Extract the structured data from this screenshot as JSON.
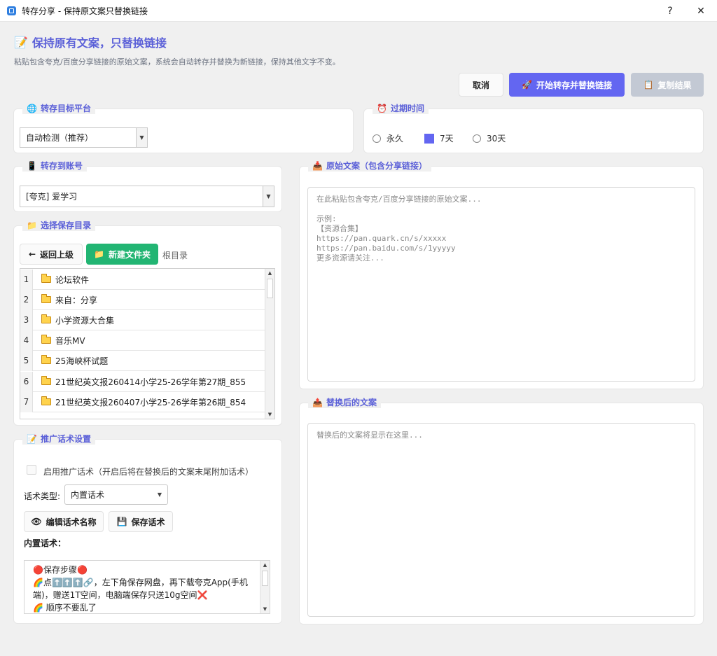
{
  "window": {
    "title": "转存分享 - 保持原文案只替换链接",
    "help": "?",
    "close": "✕"
  },
  "header": {
    "title": "保持原有文案，只替换链接",
    "description": "粘贴包含夸克/百度分享链接的原始文案，系统会自动转存并替换为新链接，保持其他文字不变。"
  },
  "actions": {
    "cancel": "取消",
    "start": "开始转存并替换链接",
    "copy": "复制结果"
  },
  "platform": {
    "legend": "转存目标平台",
    "selected": "自动检测（推荐）"
  },
  "expiry": {
    "legend": "过期时间",
    "options": [
      "永久",
      "7天",
      "30天"
    ],
    "selected": "7天"
  },
  "account": {
    "legend": "转存到账号",
    "selected": "[夸克] 爱学习"
  },
  "folder": {
    "legend": "选择保存目录",
    "back": "返回上级",
    "new_folder": "新建文件夹",
    "path": "根目录",
    "items": [
      {
        "num": "1",
        "name": "论坛软件"
      },
      {
        "num": "2",
        "name": "来自：分享"
      },
      {
        "num": "3",
        "name": "小学资源大合集"
      },
      {
        "num": "4",
        "name": "音乐MV"
      },
      {
        "num": "5",
        "name": "25海峡杯试题"
      },
      {
        "num": "6",
        "name": "21世纪英文报260414小学25-26学年第27期_855"
      },
      {
        "num": "7",
        "name": "21世纪英文报260407小学25-26学年第26期_854"
      }
    ]
  },
  "promo": {
    "legend": "推广话术设置",
    "enable_label": "启用推广话术（开启后将在替换后的文案末尾附加话术）",
    "type_label": "话术类型:",
    "type_value": "内置话术",
    "edit_name": "编辑话术名称",
    "save": "保存话术",
    "builtin_label": "内置话术：",
    "lines": [
      "🔴保存步骤🔴",
      "🌈点⬆️⬆️⬆️🔗，左下角保存网盘，再下载夸克App(手机",
      "端)，赠送1T空间，电脑端保存只送10g空间❌",
      "🌈   顺序不要乱了"
    ]
  },
  "original": {
    "legend": "原始文案（包含分享链接）",
    "placeholder": "在此粘贴包含夸克/百度分享链接的原始文案...\n\n示例:\n【资源合集】\nhttps://pan.quark.cn/s/xxxxx\nhttps://pan.baidu.com/s/1yyyyy\n更多资源请关注..."
  },
  "result": {
    "legend": "替换后的文案",
    "placeholder": "替换后的文案将显示在这里..."
  }
}
